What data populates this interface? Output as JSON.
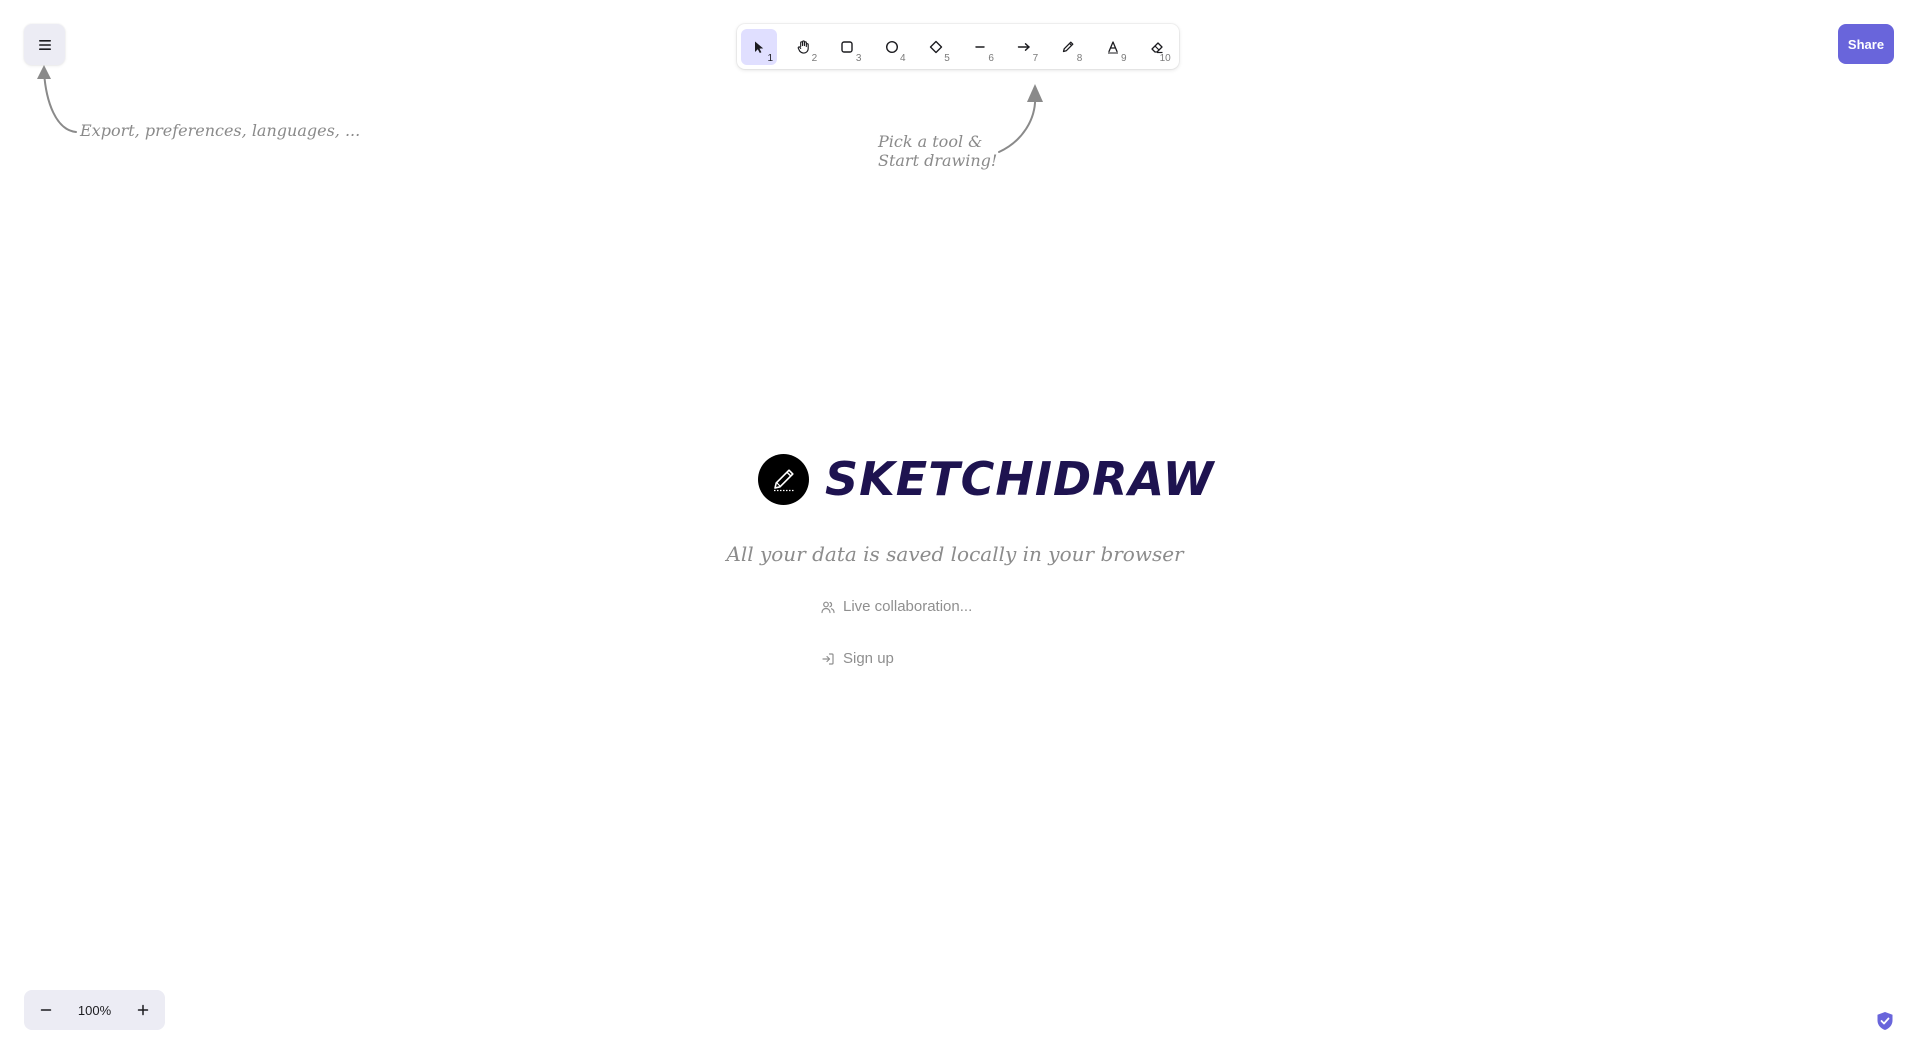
{
  "app": {
    "name": "SKETCHIDRAW",
    "accent_color": "#6965db",
    "logo_icon": "pencil-icon"
  },
  "menu": {
    "icon": "hamburger-icon"
  },
  "toolbar": {
    "tools": [
      {
        "name": "selection",
        "icon": "pointer-icon",
        "key": "1",
        "active": true
      },
      {
        "name": "hand",
        "icon": "hand-icon",
        "key": "2"
      },
      {
        "name": "rectangle",
        "icon": "rectangle-icon",
        "key": "3"
      },
      {
        "name": "ellipse",
        "icon": "circle-icon",
        "key": "4"
      },
      {
        "name": "diamond",
        "icon": "diamond-icon",
        "key": "5"
      },
      {
        "name": "line",
        "icon": "line-icon",
        "key": "6"
      },
      {
        "name": "arrow",
        "icon": "arrow-icon",
        "key": "7"
      },
      {
        "name": "draw",
        "icon": "pencil-icon",
        "key": "8"
      },
      {
        "name": "text",
        "icon": "text-icon",
        "key": "9"
      },
      {
        "name": "eraser",
        "icon": "eraser-icon",
        "key": "10"
      }
    ]
  },
  "share": {
    "label": "Share"
  },
  "hints": {
    "menu": "Export, preferences, languages, ...",
    "tool_line1": "Pick a tool &",
    "tool_line2": "Start drawing!"
  },
  "welcome": {
    "tagline": "All your data is saved locally in your browser",
    "items": [
      {
        "icon": "users-icon",
        "label": "Live collaboration..."
      },
      {
        "icon": "sign-in-icon",
        "label": "Sign up"
      }
    ]
  },
  "zoom": {
    "level": "100%",
    "zoom_out_icon": "minus-icon",
    "zoom_in_icon": "plus-icon"
  },
  "footer": {
    "icon": "shield-check-icon"
  }
}
